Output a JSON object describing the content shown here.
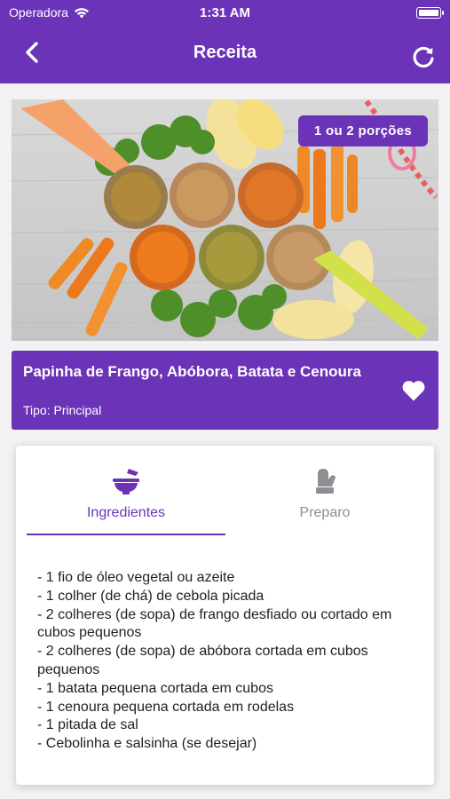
{
  "status_bar": {
    "carrier": "Operadora",
    "time": "1:31 AM"
  },
  "header": {
    "title": "Receita"
  },
  "hero": {
    "portion_badge": "1 ou 2 porções"
  },
  "recipe": {
    "title": "Papinha de Frango, Abóbora, Batata e Cenoura",
    "type": "Tipo: Principal"
  },
  "tabs": [
    {
      "label": "Ingredientes",
      "active": true
    },
    {
      "label": "Preparo",
      "active": false
    }
  ],
  "ingredients": [
    "- 1 fio de óleo vegetal ou azeite",
    "- 1 colher (de chá) de cebola picada",
    "- 2 colheres (de sopa) de frango desfiado ou cortado em cubos pequenos",
    "- 2 colheres (de sopa) de abóbora cortada em cubos pequenos",
    "- 1 batata pequena cortada em cubos",
    "- 1 cenoura pequena cortada em rodelas",
    "- 1 pitada de sal",
    "- Cebolinha e salsinha (se desejar)"
  ],
  "colors": {
    "primary": "#6a33b8",
    "inactive": "#8e8e93",
    "background": "#f2f2f4"
  },
  "icons": {
    "back": "chevron-left-icon",
    "refresh": "refresh-icon",
    "favorite": "heart-icon",
    "ingredients_tab": "mortar-pestle-icon",
    "preparo_tab": "oven-mitt-icon"
  }
}
